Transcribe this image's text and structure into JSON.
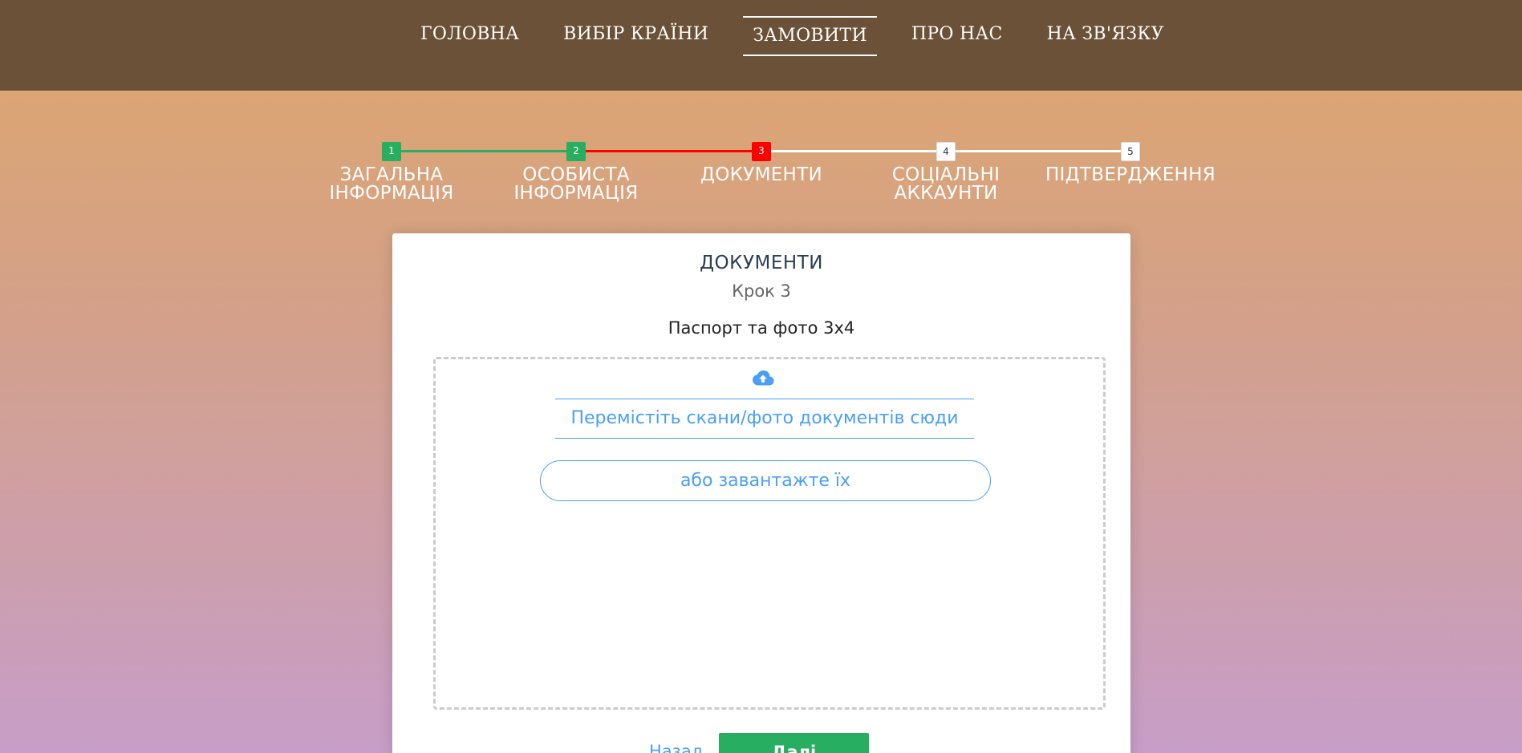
{
  "nav": {
    "items": [
      {
        "label": "ГОЛОВНА",
        "active": false
      },
      {
        "label": "ВИБІР КРАЇНИ",
        "active": false
      },
      {
        "label": "ЗАМОВИТИ",
        "active": true
      },
      {
        "label": "ПРО НАС",
        "active": false
      },
      {
        "label": "НА ЗВ'ЯЗКУ",
        "active": false
      }
    ]
  },
  "stepper": {
    "current_step": 3,
    "steps": [
      {
        "number": "1",
        "label": "ЗАГАЛЬНА ІНФОРМАЦІЯ",
        "status": "completed"
      },
      {
        "number": "2",
        "label": "ОСОБИСТА ІНФОРМАЦІЯ",
        "status": "completed"
      },
      {
        "number": "3",
        "label": "ДОКУМЕНТИ",
        "status": "current"
      },
      {
        "number": "4",
        "label": "СОЦІАЛЬНІ АККАУНТИ",
        "status": "pending"
      },
      {
        "number": "5",
        "label": "ПІДТВЕРДЖЕННЯ",
        "status": "pending"
      }
    ],
    "colors": {
      "completed": "#27ae60",
      "current": "#ff0000",
      "pending": "#ffffff"
    }
  },
  "form": {
    "title": "ДОКУМЕНТИ",
    "subtitle": "Крок 3",
    "field_label": "Паспорт та фото 3х4",
    "dropzone": {
      "icon": "cloud-upload-icon",
      "text": "Перемістіть скани/фото документів сюди",
      "button_label": "або завантажте їх"
    },
    "back_label": "Назад",
    "next_label": "Далі"
  },
  "colors": {
    "header_bg": "#6b5137",
    "accent": "#4a9ff5",
    "primary_button": "#27ae60"
  }
}
